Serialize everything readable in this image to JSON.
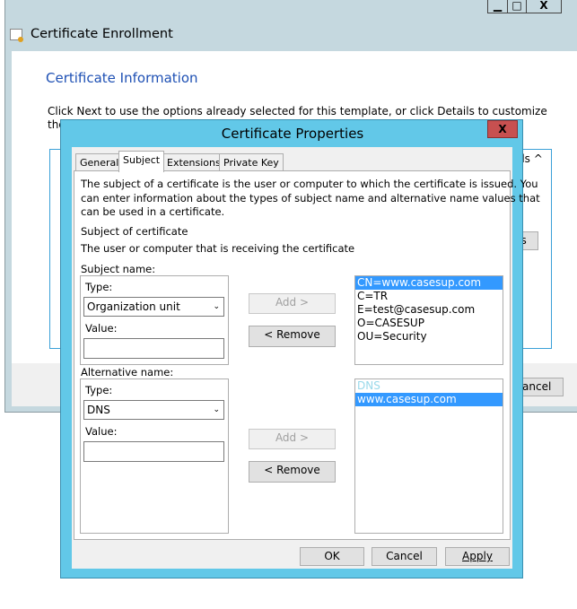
{
  "background_window": {
    "title": "Certificate Enrollment",
    "heading": "Certificate Information",
    "instruction": "Click Next to use the options already selected for this template, or click Details to customize the certificate rec",
    "details_fragment": "ils ^",
    "button_fragment": "es",
    "cancel_fragment": "Cancel",
    "minimize": "▁",
    "maximize": "□",
    "close": "X"
  },
  "dialog": {
    "title": "Certificate Properties",
    "close": "X",
    "tabs": [
      {
        "label": "General"
      },
      {
        "label": "Subject"
      },
      {
        "label": "Extensions"
      },
      {
        "label": "Private Key"
      }
    ],
    "description": "The subject of a certificate is the user or computer to which the certificate is issued. You can enter information about the types of subject name and alternative name values that can be used in a certificate.",
    "desc_lines": [
      "The subject of a certificate is the user or computer to which the certificate is issued. You",
      "can enter information about the types of subject name and alternative name values that",
      "can be used in a certificate."
    ],
    "subject_heading": "Subject of certificate",
    "subject_sub": "The user or computer that is receiving the certificate",
    "subject_name": {
      "label": "Subject name:",
      "type_label": "Type:",
      "type_value": "Organization unit",
      "value_label": "Value:",
      "value": "",
      "add": "Add >",
      "remove": "< Remove",
      "entries": [
        "CN=www.casesup.com",
        "C=TR",
        "E=test@casesup.com",
        "O=CASESUP",
        "OU=Security"
      ]
    },
    "alt_name": {
      "label": "Alternative name:",
      "type_label": "Type:",
      "type_value": "DNS",
      "value_label": "Value:",
      "value": "",
      "add": "Add >",
      "remove": "< Remove",
      "entries": [
        "DNS",
        "www.casesup.com"
      ]
    },
    "buttons": {
      "ok": "OK",
      "cancel": "Cancel",
      "apply": "Apply"
    }
  }
}
